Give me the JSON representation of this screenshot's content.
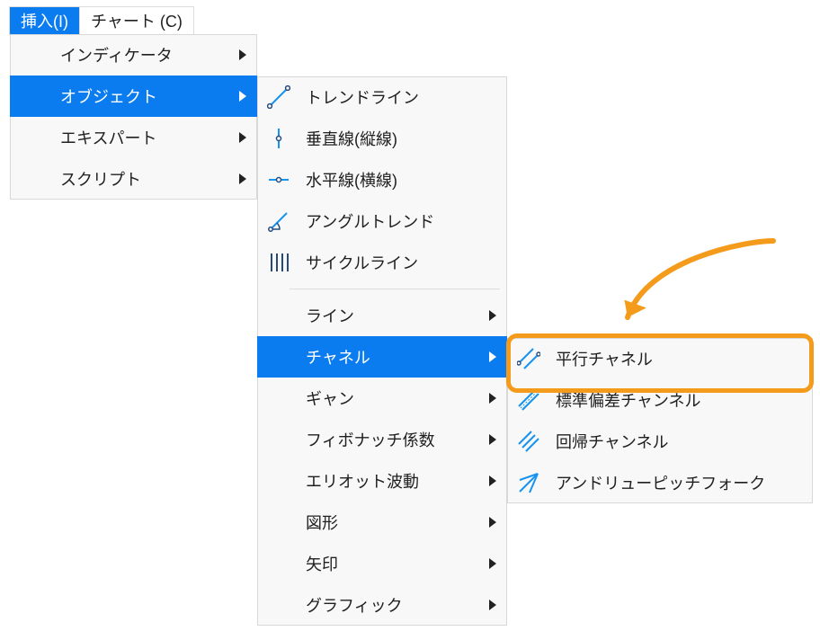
{
  "menubar": {
    "insert": "挿入(I)",
    "chart": "チャート (C)"
  },
  "menu1": {
    "indicators": "インディケータ",
    "objects": "オブジェクト",
    "experts": "エキスパート",
    "scripts": "スクリプト"
  },
  "menu2": {
    "trendline": "トレンドライン",
    "vertical": "垂直線(縦線)",
    "horizontal": "水平線(横線)",
    "angletrend": "アングルトレンド",
    "cycleline": "サイクルライン",
    "line": "ライン",
    "channel": "チャネル",
    "gann": "ギャン",
    "fibonacci": "フィボナッチ係数",
    "elliott": "エリオット波動",
    "shapes": "図形",
    "arrows": "矢印",
    "graphic": "グラフィック"
  },
  "menu3": {
    "parallel": "平行チャネル",
    "stddev": "標準偏差チャンネル",
    "regression": "回帰チャンネル",
    "pitchfork": "アンドリューピッチフォーク"
  },
  "colors": {
    "select": "#0a7cef",
    "iconblue": "#1793f0",
    "iconnavy": "#254b7e",
    "highlight": "#f49b1b"
  }
}
